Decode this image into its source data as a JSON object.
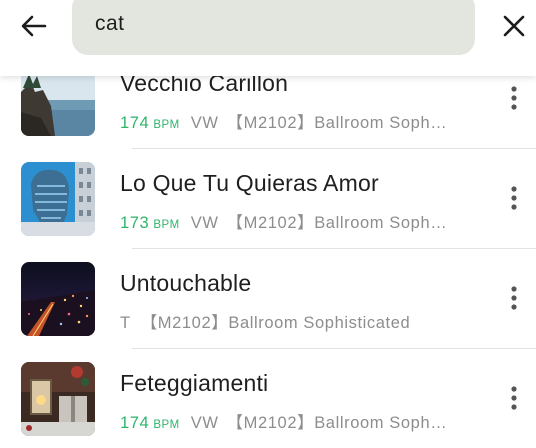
{
  "search": {
    "value": "cat"
  },
  "results": [
    {
      "title": "Vecchio Carillon",
      "bpm": "174",
      "bpm_unit": "BPM",
      "key": "VW",
      "playlist": "【M2102】Ballroom Soph…",
      "thumb": "coast-cliff"
    },
    {
      "title": "Lo Que Tu Quieras Amor",
      "bpm": "173",
      "bpm_unit": "BPM",
      "key": "VW",
      "playlist": "【M2102】Ballroom Soph…",
      "thumb": "glass-head-sculpture"
    },
    {
      "title": "Untouchable",
      "bpm": "",
      "bpm_unit": "",
      "key": "T",
      "playlist": "【M2102】Ballroom Sophisticated",
      "thumb": "city-night"
    },
    {
      "title": "Feteggiamenti",
      "bpm": "174",
      "bpm_unit": "BPM",
      "key": "VW",
      "playlist": "【M2102】Ballroom Soph…",
      "thumb": "lantern-gifts"
    }
  ],
  "colors": {
    "accent_bpm": "#2db56a",
    "search_bg": "#e2e6de"
  },
  "icons": {
    "back": "arrow-left-icon",
    "clear": "close-icon",
    "more": "more-vert-icon"
  }
}
